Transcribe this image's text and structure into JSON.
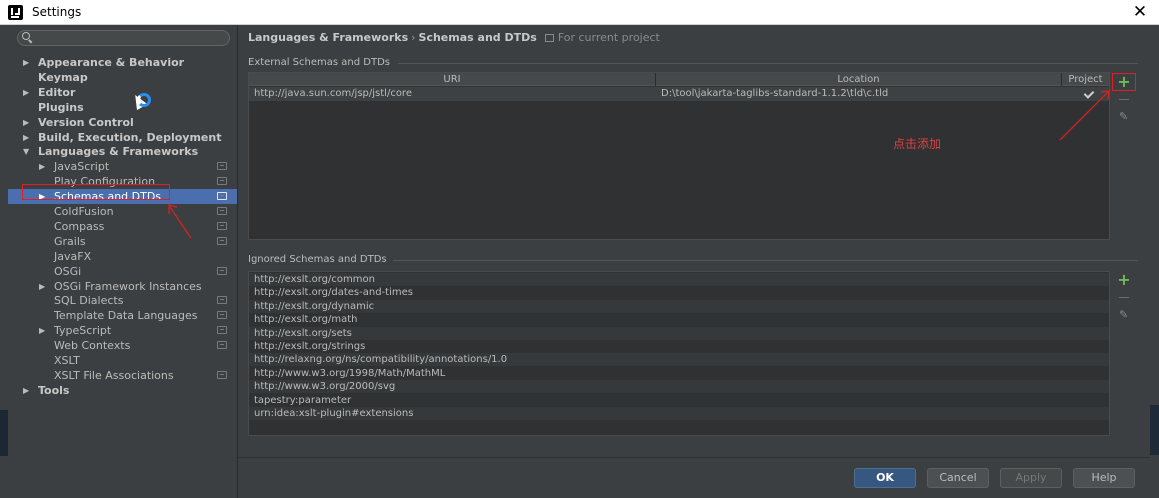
{
  "window": {
    "title": "Settings",
    "close": "✕"
  },
  "sidebar": {
    "search_placeholder": "",
    "items": [
      {
        "label": "Appearance & Behavior",
        "level": 0,
        "arrow": "▶",
        "bold": true
      },
      {
        "label": "Keymap",
        "level": 0,
        "arrow": "",
        "bold": true
      },
      {
        "label": "Editor",
        "level": 0,
        "arrow": "▶",
        "bold": true
      },
      {
        "label": "Plugins",
        "level": 0,
        "arrow": "",
        "bold": true
      },
      {
        "label": "Version Control",
        "level": 0,
        "arrow": "▶",
        "bold": true
      },
      {
        "label": "Build, Execution, Deployment",
        "level": 0,
        "arrow": "▶",
        "bold": true
      },
      {
        "label": "Languages & Frameworks",
        "level": 0,
        "arrow": "▼",
        "bold": true
      },
      {
        "label": "JavaScript",
        "level": 1,
        "arrow": "▶",
        "project": true
      },
      {
        "label": "Play Configuration",
        "level": 1,
        "arrow": "",
        "project": true
      },
      {
        "label": "Schemas and DTDs",
        "level": 1,
        "arrow": "▶",
        "project": true,
        "selected": true
      },
      {
        "label": "ColdFusion",
        "level": 1,
        "arrow": "",
        "project": true
      },
      {
        "label": "Compass",
        "level": 1,
        "arrow": "",
        "project": true
      },
      {
        "label": "Grails",
        "level": 1,
        "arrow": "",
        "project": true
      },
      {
        "label": "JavaFX",
        "level": 1,
        "arrow": ""
      },
      {
        "label": "OSGi",
        "level": 1,
        "arrow": "",
        "project": true
      },
      {
        "label": "OSGi Framework Instances",
        "level": 1,
        "arrow": "▶"
      },
      {
        "label": "SQL Dialects",
        "level": 1,
        "arrow": "",
        "project": true
      },
      {
        "label": "Template Data Languages",
        "level": 1,
        "arrow": "",
        "project": true
      },
      {
        "label": "TypeScript",
        "level": 1,
        "arrow": "▶",
        "project": true
      },
      {
        "label": "Web Contexts",
        "level": 1,
        "arrow": "",
        "project": true
      },
      {
        "label": "XSLT",
        "level": 1,
        "arrow": ""
      },
      {
        "label": "XSLT File Associations",
        "level": 1,
        "arrow": "",
        "project": true
      },
      {
        "label": "Tools",
        "level": 0,
        "arrow": "▶",
        "bold": true
      }
    ]
  },
  "breadcrumb": {
    "part1": "Languages & Frameworks",
    "sep": "›",
    "part2": "Schemas and DTDs",
    "scope": "For current project"
  },
  "external": {
    "title": "External Schemas and DTDs",
    "headers": [
      "URI",
      "Location",
      "Project"
    ],
    "rows": [
      {
        "uri": "http://java.sun.com/jsp/jstl/core",
        "location": "D:\\tool\\jakarta-taglibs-standard-1.1.2\\tld\\c.tld",
        "project": true
      }
    ]
  },
  "ignored": {
    "title": "Ignored Schemas and DTDs",
    "rows": [
      "http://exslt.org/common",
      "http://exslt.org/dates-and-times",
      "http://exslt.org/dynamic",
      "http://exslt.org/math",
      "http://exslt.org/sets",
      "http://exslt.org/strings",
      "http://relaxng.org/ns/compatibility/annotations/1.0",
      "http://www.w3.org/1998/Math/MathML",
      "http://www.w3.org/2000/svg",
      "tapestry:parameter",
      "urn:idea:xslt-plugin#extensions"
    ]
  },
  "toolbar": {
    "add": "+",
    "edit": "✎"
  },
  "annotation": "点击添加",
  "buttons": {
    "ok": "OK",
    "cancel": "Cancel",
    "apply": "Apply",
    "help": "Help"
  },
  "colors": {
    "selection": "#4b6eaf",
    "accent_red": "#e02020",
    "add_green": "#6dbb57",
    "primary_button": "#365880"
  }
}
